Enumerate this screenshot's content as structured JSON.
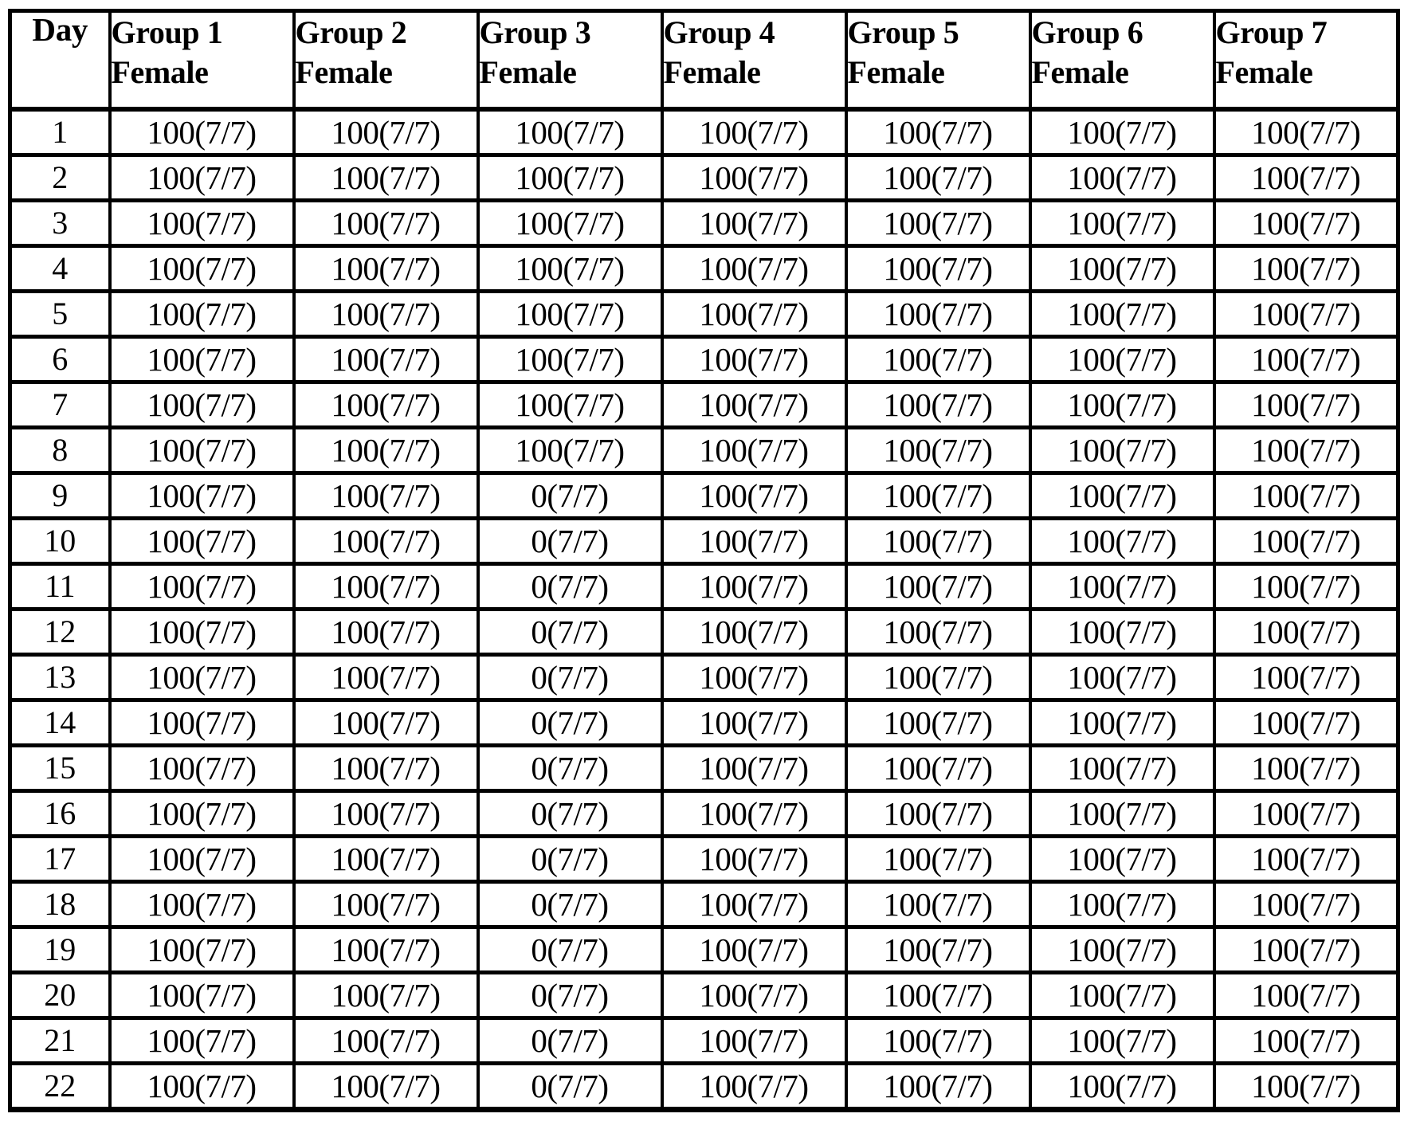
{
  "table": {
    "caption": "",
    "day_header": "Day",
    "group_headers": [
      {
        "line1": "Group 1",
        "line2": "Female"
      },
      {
        "line1": "Group 2",
        "line2": "Female"
      },
      {
        "line1": "Group 3",
        "line2": "Female"
      },
      {
        "line1": "Group 4",
        "line2": "Female"
      },
      {
        "line1": "Group 5",
        "line2": "Female"
      },
      {
        "line1": "Group 6",
        "line2": "Female"
      },
      {
        "line1": "Group 7",
        "line2": "Female"
      }
    ],
    "rows": [
      {
        "day": "1",
        "values": [
          "100(7/7)",
          "100(7/7)",
          "100(7/7)",
          "100(7/7)",
          "100(7/7)",
          "100(7/7)",
          "100(7/7)"
        ]
      },
      {
        "day": "2",
        "values": [
          "100(7/7)",
          "100(7/7)",
          "100(7/7)",
          "100(7/7)",
          "100(7/7)",
          "100(7/7)",
          "100(7/7)"
        ]
      },
      {
        "day": "3",
        "values": [
          "100(7/7)",
          "100(7/7)",
          "100(7/7)",
          "100(7/7)",
          "100(7/7)",
          "100(7/7)",
          "100(7/7)"
        ]
      },
      {
        "day": "4",
        "values": [
          "100(7/7)",
          "100(7/7)",
          "100(7/7)",
          "100(7/7)",
          "100(7/7)",
          "100(7/7)",
          "100(7/7)"
        ]
      },
      {
        "day": "5",
        "values": [
          "100(7/7)",
          "100(7/7)",
          "100(7/7)",
          "100(7/7)",
          "100(7/7)",
          "100(7/7)",
          "100(7/7)"
        ]
      },
      {
        "day": "6",
        "values": [
          "100(7/7)",
          "100(7/7)",
          "100(7/7)",
          "100(7/7)",
          "100(7/7)",
          "100(7/7)",
          "100(7/7)"
        ]
      },
      {
        "day": "7",
        "values": [
          "100(7/7)",
          "100(7/7)",
          "100(7/7)",
          "100(7/7)",
          "100(7/7)",
          "100(7/7)",
          "100(7/7)"
        ]
      },
      {
        "day": "8",
        "values": [
          "100(7/7)",
          "100(7/7)",
          "100(7/7)",
          "100(7/7)",
          "100(7/7)",
          "100(7/7)",
          "100(7/7)"
        ]
      },
      {
        "day": "9",
        "values": [
          "100(7/7)",
          "100(7/7)",
          "0(7/7)",
          "100(7/7)",
          "100(7/7)",
          "100(7/7)",
          "100(7/7)"
        ]
      },
      {
        "day": "10",
        "values": [
          "100(7/7)",
          "100(7/7)",
          "0(7/7)",
          "100(7/7)",
          "100(7/7)",
          "100(7/7)",
          "100(7/7)"
        ]
      },
      {
        "day": "11",
        "values": [
          "100(7/7)",
          "100(7/7)",
          "0(7/7)",
          "100(7/7)",
          "100(7/7)",
          "100(7/7)",
          "100(7/7)"
        ]
      },
      {
        "day": "12",
        "values": [
          "100(7/7)",
          "100(7/7)",
          "0(7/7)",
          "100(7/7)",
          "100(7/7)",
          "100(7/7)",
          "100(7/7)"
        ]
      },
      {
        "day": "13",
        "values": [
          "100(7/7)",
          "100(7/7)",
          "0(7/7)",
          "100(7/7)",
          "100(7/7)",
          "100(7/7)",
          "100(7/7)"
        ]
      },
      {
        "day": "14",
        "values": [
          "100(7/7)",
          "100(7/7)",
          "0(7/7)",
          "100(7/7)",
          "100(7/7)",
          "100(7/7)",
          "100(7/7)"
        ]
      },
      {
        "day": "15",
        "values": [
          "100(7/7)",
          "100(7/7)",
          "0(7/7)",
          "100(7/7)",
          "100(7/7)",
          "100(7/7)",
          "100(7/7)"
        ]
      },
      {
        "day": "16",
        "values": [
          "100(7/7)",
          "100(7/7)",
          "0(7/7)",
          "100(7/7)",
          "100(7/7)",
          "100(7/7)",
          "100(7/7)"
        ]
      },
      {
        "day": "17",
        "values": [
          "100(7/7)",
          "100(7/7)",
          "0(7/7)",
          "100(7/7)",
          "100(7/7)",
          "100(7/7)",
          "100(7/7)"
        ]
      },
      {
        "day": "18",
        "values": [
          "100(7/7)",
          "100(7/7)",
          "0(7/7)",
          "100(7/7)",
          "100(7/7)",
          "100(7/7)",
          "100(7/7)"
        ]
      },
      {
        "day": "19",
        "values": [
          "100(7/7)",
          "100(7/7)",
          "0(7/7)",
          "100(7/7)",
          "100(7/7)",
          "100(7/7)",
          "100(7/7)"
        ]
      },
      {
        "day": "20",
        "values": [
          "100(7/7)",
          "100(7/7)",
          "0(7/7)",
          "100(7/7)",
          "100(7/7)",
          "100(7/7)",
          "100(7/7)"
        ]
      },
      {
        "day": "21",
        "values": [
          "100(7/7)",
          "100(7/7)",
          "0(7/7)",
          "100(7/7)",
          "100(7/7)",
          "100(7/7)",
          "100(7/7)"
        ]
      },
      {
        "day": "22",
        "values": [
          "100(7/7)",
          "100(7/7)",
          "0(7/7)",
          "100(7/7)",
          "100(7/7)",
          "100(7/7)",
          "100(7/7)"
        ]
      }
    ]
  },
  "colors": {
    "border": "#000000",
    "text": "#000000",
    "background": "#ffffff"
  }
}
